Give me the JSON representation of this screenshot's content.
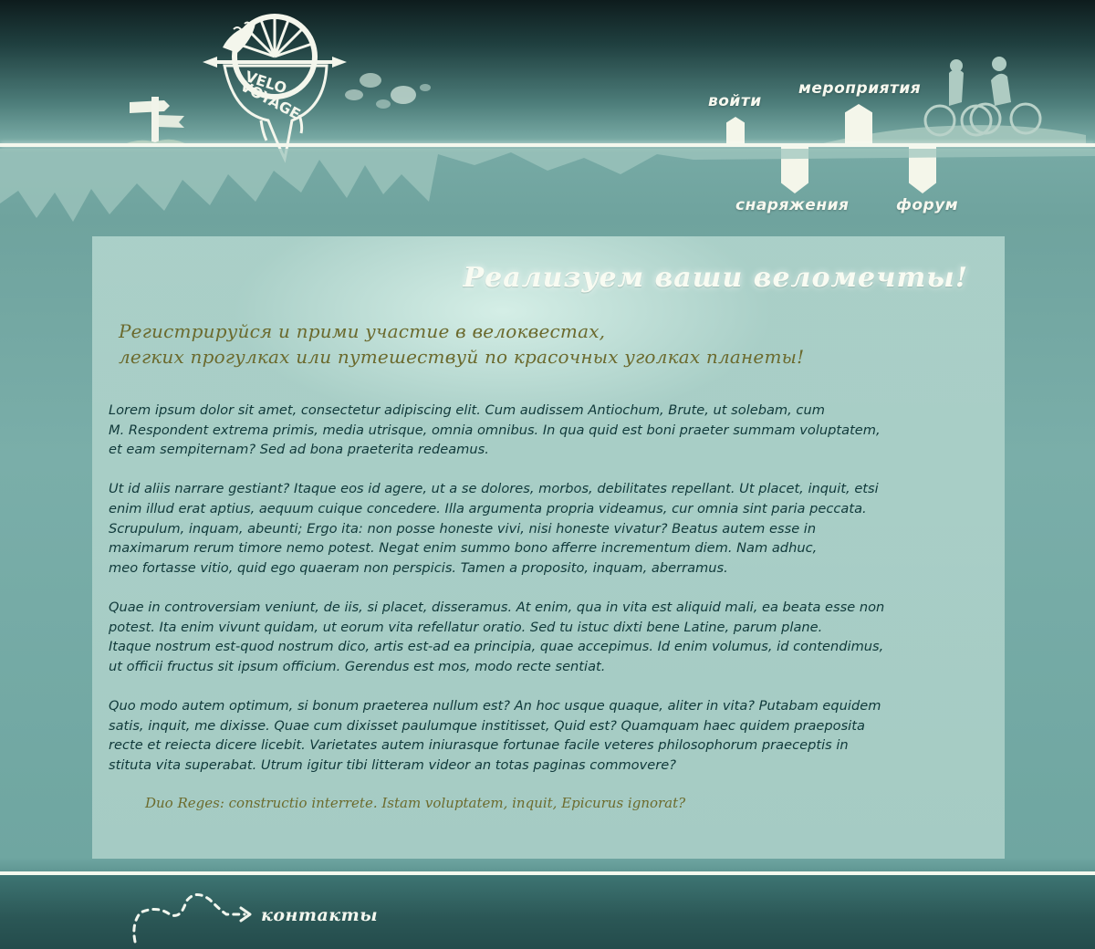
{
  "logo": {
    "text_line1": "VELO",
    "text_line2": "VOYAGE"
  },
  "nav": {
    "login": "войти",
    "events": "мероприятия",
    "equipment": "снаряжения",
    "forum": "форум"
  },
  "hero": {
    "title": "Реализуем ваши веломечты!",
    "tagline_line1": "Регистрируйся и прими участие в велоквестах,",
    "tagline_line2": "легких прогулках или путешествуй по красочных уголках планеты!"
  },
  "content": {
    "paragraphs": [
      [
        "Lorem ipsum dolor sit amet, consectetur adipiscing elit. Cum audissem Antiochum, Brute, ut solebam, cum",
        "M. Respondent extrema primis, media utrisque, omnia omnibus. In qua quid est boni praeter summam voluptatem,",
        "et eam sempiternam? Sed ad bona praeterita redeamus."
      ],
      [
        "Ut id aliis narrare gestiant? Itaque eos id agere, ut a se dolores, morbos, debilitates repellant. Ut placet, inquit, etsi",
        "enim illud erat aptius, aequum cuique concedere. Illa argumenta propria videamus, cur omnia sint paria peccata.",
        "Scrupulum, inquam, abeunti; Ergo ita: non posse honeste vivi, nisi honeste vivatur? Beatus autem esse in",
        "maximarum rerum timore nemo potest. Negat enim summo bono afferre incrementum diem. Nam adhuc,",
        "meo fortasse vitio, quid ego quaeram non perspicis. Tamen a proposito, inquam, aberramus."
      ],
      [
        "Quae in controversiam veniunt, de iis, si placet, disseramus. At enim, qua in vita est aliquid mali, ea beata esse non",
        "potest. Ita enim vivunt quidam, ut eorum vita refellatur oratio. Sed tu istuc dixti bene Latine, parum plane.",
        "Itaque nostrum est-quod nostrum dico, artis est-ad ea principia, quae accepimus. Id enim volumus, id contendimus,",
        "ut officii fructus sit ipsum officium. Gerendus est mos, modo recte sentiat."
      ],
      [
        "Quo modo autem optimum, si bonum praeterea nullum est? An hoc usque quaque, aliter in vita? Putabam equidem",
        "satis, inquit, me dixisse. Quae cum dixisset paulumque institisset, Quid est? Quamquam haec quidem praeposita",
        "recte et reiecta dicere licebit. Varietates autem iniurasque fortunae facile veteres philosophorum praeceptis in",
        "stituta vita superabat. Utrum igitur tibi litteram videor an totas paginas commovere?"
      ]
    ],
    "quote": "Duo Reges: constructio interrete. Istam voluptatem, inquit, Epicurus ignorat?"
  },
  "footer": {
    "contacts": "контакты"
  },
  "colors": {
    "header_dark": "#0e1c1d",
    "teal_bg": "#77aaa5",
    "panel_bg": "#a9cdc6",
    "white_line": "#f4f8ee",
    "body_text": "#10393a",
    "olive_text": "#6b6a2e"
  }
}
